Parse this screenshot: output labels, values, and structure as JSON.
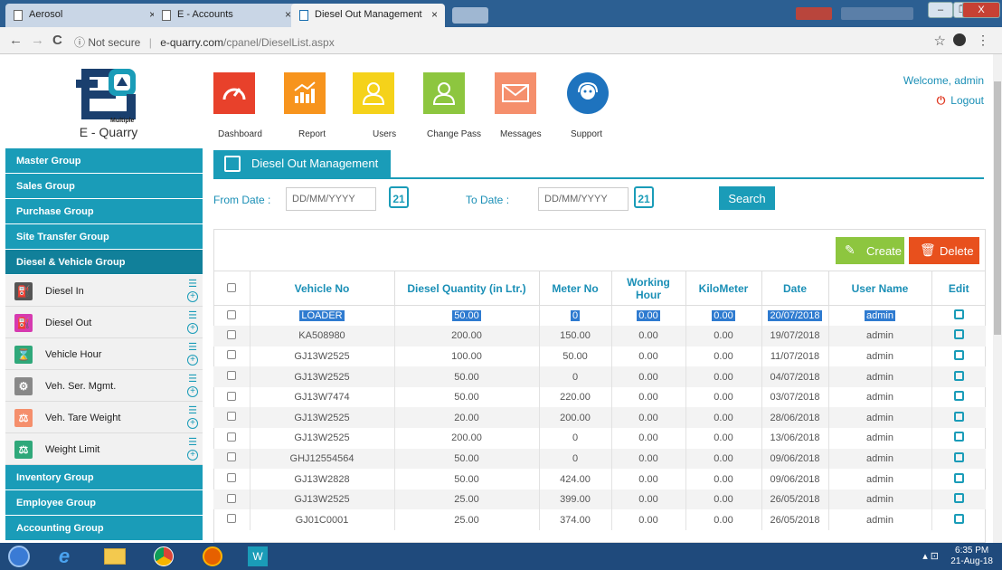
{
  "browser": {
    "tabs": [
      {
        "label": "Aerosol",
        "close": "×"
      },
      {
        "label": "E - Accounts",
        "close": "×"
      },
      {
        "label": "Diesel Out Management",
        "close": "×"
      }
    ],
    "window_controls": {
      "minimize": "–",
      "restore": "❐",
      "close": "X"
    },
    "nav": {
      "back": "←",
      "forward": "→",
      "reload": "C"
    },
    "address": {
      "security": "ⓘ Not secure",
      "separator": "|",
      "domain": "e-quarry.com",
      "path": "/cpanel/DieselList.aspx"
    },
    "star": "☆",
    "menu": "⋮"
  },
  "logo": {
    "name": "E - Quarry",
    "tag": "Multiple"
  },
  "topnav": [
    {
      "label": "Dashboard",
      "icon": "speedometer-icon",
      "color": "#e8412b"
    },
    {
      "label": "Report",
      "icon": "chart-icon",
      "color": "#f7941d"
    },
    {
      "label": "Users",
      "icon": "user-icon",
      "color": "#f5d21a"
    },
    {
      "label": "Change Pass",
      "icon": "user-outline-icon",
      "color": "#8dc63f"
    },
    {
      "label": "Messages",
      "icon": "envelope-icon",
      "color": "#f58f6c"
    },
    {
      "label": "Support",
      "icon": "support-agent-icon",
      "color": "#1e73be"
    }
  ],
  "user": {
    "welcome": "Welcome, admin",
    "logout": "Logout",
    "logout_icon": "⏻"
  },
  "sidebar": {
    "groups_top": [
      "Master Group",
      "Sales Group",
      "Purchase Group",
      "Site Transfer Group",
      "Diesel & Vehicle Group"
    ],
    "items": [
      {
        "label": "Diesel In",
        "icon": "fuel-icon",
        "color": "#555555"
      },
      {
        "label": "Diesel Out",
        "icon": "fuel-icon",
        "color": "#d63ab0"
      },
      {
        "label": "Vehicle Hour",
        "icon": "hourglass-icon",
        "color": "#2fa87a"
      },
      {
        "label": "Veh. Ser. Mgmt.",
        "icon": "car-icon",
        "color": "#888888"
      },
      {
        "label": "Veh. Tare Weight",
        "icon": "scale-icon",
        "color": "#f58f6c"
      },
      {
        "label": "Weight Limit",
        "icon": "balance-icon",
        "color": "#2fa87a"
      }
    ],
    "item_list_glyph": "☰",
    "item_plus_glyph": "+",
    "groups_bottom": [
      "Inventory Group",
      "Employee Group",
      "Accounting Group"
    ]
  },
  "panel": {
    "title": "Diesel Out Management",
    "from_label": "From Date :",
    "from_placeholder": "DD/MM/YYYY",
    "to_label": "To Date :",
    "to_placeholder": "DD/MM/YYYY",
    "calendar_glyph": "21",
    "search": "Search",
    "create": "Create",
    "delete": "Delete"
  },
  "table": {
    "headers": [
      "Vehicle No",
      "Diesel Quantity (in Ltr.)",
      "Meter No",
      "Working Hour",
      "KiloMeter",
      "Date",
      "User Name",
      "Edit"
    ],
    "rows": [
      [
        "LOADER",
        "50.00",
        "0",
        "0.00",
        "0.00",
        "20/07/2018",
        "admin"
      ],
      [
        "KA508980",
        "200.00",
        "150.00",
        "0.00",
        "0.00",
        "19/07/2018",
        "admin"
      ],
      [
        "GJ13W2525",
        "100.00",
        "50.00",
        "0.00",
        "0.00",
        "11/07/2018",
        "admin"
      ],
      [
        "GJ13W2525",
        "50.00",
        "0",
        "0.00",
        "0.00",
        "04/07/2018",
        "admin"
      ],
      [
        "GJ13W7474",
        "50.00",
        "220.00",
        "0.00",
        "0.00",
        "03/07/2018",
        "admin"
      ],
      [
        "GJ13W2525",
        "20.00",
        "200.00",
        "0.00",
        "0.00",
        "28/06/2018",
        "admin"
      ],
      [
        "GJ13W2525",
        "200.00",
        "0",
        "0.00",
        "0.00",
        "13/06/2018",
        "admin"
      ],
      [
        "GHJ12554564",
        "50.00",
        "0",
        "0.00",
        "0.00",
        "09/06/2018",
        "admin"
      ],
      [
        "GJ13W2828",
        "50.00",
        "424.00",
        "0.00",
        "0.00",
        "09/06/2018",
        "admin"
      ],
      [
        "GJ13W2525",
        "25.00",
        "399.00",
        "0.00",
        "0.00",
        "26/05/2018",
        "admin"
      ],
      [
        "GJ01C0001",
        "25.00",
        "374.00",
        "0.00",
        "0.00",
        "26/05/2018",
        "admin"
      ]
    ]
  },
  "taskbar": {
    "apps": [
      "windows-start-icon",
      "internet-explorer-icon",
      "file-explorer-icon",
      "chrome-icon",
      "firefox-icon",
      "app-icon"
    ],
    "time": "6:35 PM",
    "date": "21-Aug-18"
  }
}
